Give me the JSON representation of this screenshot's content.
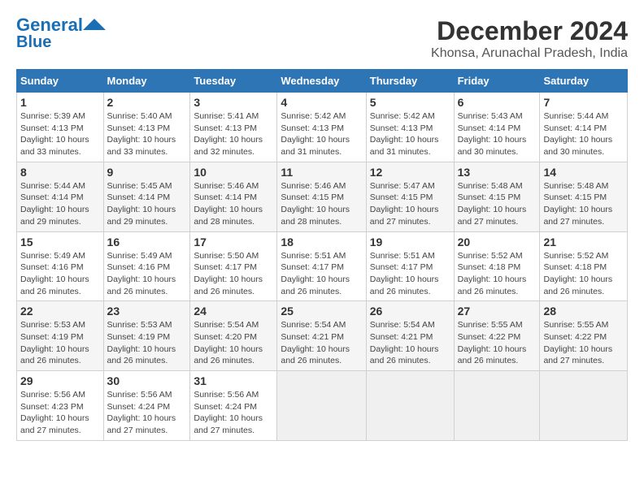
{
  "header": {
    "logo_line1": "General",
    "logo_line2": "Blue",
    "title": "December 2024",
    "subtitle": "Khonsa, Arunachal Pradesh, India"
  },
  "days_of_week": [
    "Sunday",
    "Monday",
    "Tuesday",
    "Wednesday",
    "Thursday",
    "Friday",
    "Saturday"
  ],
  "weeks": [
    [
      {
        "day": "1",
        "info": "Sunrise: 5:39 AM\nSunset: 4:13 PM\nDaylight: 10 hours\nand 33 minutes."
      },
      {
        "day": "2",
        "info": "Sunrise: 5:40 AM\nSunset: 4:13 PM\nDaylight: 10 hours\nand 33 minutes."
      },
      {
        "day": "3",
        "info": "Sunrise: 5:41 AM\nSunset: 4:13 PM\nDaylight: 10 hours\nand 32 minutes."
      },
      {
        "day": "4",
        "info": "Sunrise: 5:42 AM\nSunset: 4:13 PM\nDaylight: 10 hours\nand 31 minutes."
      },
      {
        "day": "5",
        "info": "Sunrise: 5:42 AM\nSunset: 4:13 PM\nDaylight: 10 hours\nand 31 minutes."
      },
      {
        "day": "6",
        "info": "Sunrise: 5:43 AM\nSunset: 4:14 PM\nDaylight: 10 hours\nand 30 minutes."
      },
      {
        "day": "7",
        "info": "Sunrise: 5:44 AM\nSunset: 4:14 PM\nDaylight: 10 hours\nand 30 minutes."
      }
    ],
    [
      {
        "day": "8",
        "info": "Sunrise: 5:44 AM\nSunset: 4:14 PM\nDaylight: 10 hours\nand 29 minutes."
      },
      {
        "day": "9",
        "info": "Sunrise: 5:45 AM\nSunset: 4:14 PM\nDaylight: 10 hours\nand 29 minutes."
      },
      {
        "day": "10",
        "info": "Sunrise: 5:46 AM\nSunset: 4:14 PM\nDaylight: 10 hours\nand 28 minutes."
      },
      {
        "day": "11",
        "info": "Sunrise: 5:46 AM\nSunset: 4:15 PM\nDaylight: 10 hours\nand 28 minutes."
      },
      {
        "day": "12",
        "info": "Sunrise: 5:47 AM\nSunset: 4:15 PM\nDaylight: 10 hours\nand 27 minutes."
      },
      {
        "day": "13",
        "info": "Sunrise: 5:48 AM\nSunset: 4:15 PM\nDaylight: 10 hours\nand 27 minutes."
      },
      {
        "day": "14",
        "info": "Sunrise: 5:48 AM\nSunset: 4:15 PM\nDaylight: 10 hours\nand 27 minutes."
      }
    ],
    [
      {
        "day": "15",
        "info": "Sunrise: 5:49 AM\nSunset: 4:16 PM\nDaylight: 10 hours\nand 26 minutes."
      },
      {
        "day": "16",
        "info": "Sunrise: 5:49 AM\nSunset: 4:16 PM\nDaylight: 10 hours\nand 26 minutes."
      },
      {
        "day": "17",
        "info": "Sunrise: 5:50 AM\nSunset: 4:17 PM\nDaylight: 10 hours\nand 26 minutes."
      },
      {
        "day": "18",
        "info": "Sunrise: 5:51 AM\nSunset: 4:17 PM\nDaylight: 10 hours\nand 26 minutes."
      },
      {
        "day": "19",
        "info": "Sunrise: 5:51 AM\nSunset: 4:17 PM\nDaylight: 10 hours\nand 26 minutes."
      },
      {
        "day": "20",
        "info": "Sunrise: 5:52 AM\nSunset: 4:18 PM\nDaylight: 10 hours\nand 26 minutes."
      },
      {
        "day": "21",
        "info": "Sunrise: 5:52 AM\nSunset: 4:18 PM\nDaylight: 10 hours\nand 26 minutes."
      }
    ],
    [
      {
        "day": "22",
        "info": "Sunrise: 5:53 AM\nSunset: 4:19 PM\nDaylight: 10 hours\nand 26 minutes."
      },
      {
        "day": "23",
        "info": "Sunrise: 5:53 AM\nSunset: 4:19 PM\nDaylight: 10 hours\nand 26 minutes."
      },
      {
        "day": "24",
        "info": "Sunrise: 5:54 AM\nSunset: 4:20 PM\nDaylight: 10 hours\nand 26 minutes."
      },
      {
        "day": "25",
        "info": "Sunrise: 5:54 AM\nSunset: 4:21 PM\nDaylight: 10 hours\nand 26 minutes."
      },
      {
        "day": "26",
        "info": "Sunrise: 5:54 AM\nSunset: 4:21 PM\nDaylight: 10 hours\nand 26 minutes."
      },
      {
        "day": "27",
        "info": "Sunrise: 5:55 AM\nSunset: 4:22 PM\nDaylight: 10 hours\nand 26 minutes."
      },
      {
        "day": "28",
        "info": "Sunrise: 5:55 AM\nSunset: 4:22 PM\nDaylight: 10 hours\nand 27 minutes."
      }
    ],
    [
      {
        "day": "29",
        "info": "Sunrise: 5:56 AM\nSunset: 4:23 PM\nDaylight: 10 hours\nand 27 minutes."
      },
      {
        "day": "30",
        "info": "Sunrise: 5:56 AM\nSunset: 4:24 PM\nDaylight: 10 hours\nand 27 minutes."
      },
      {
        "day": "31",
        "info": "Sunrise: 5:56 AM\nSunset: 4:24 PM\nDaylight: 10 hours\nand 27 minutes."
      },
      {
        "day": "",
        "info": ""
      },
      {
        "day": "",
        "info": ""
      },
      {
        "day": "",
        "info": ""
      },
      {
        "day": "",
        "info": ""
      }
    ]
  ]
}
